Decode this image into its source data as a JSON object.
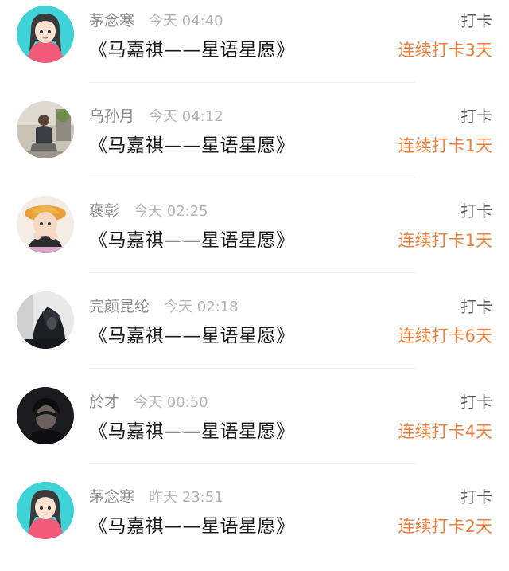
{
  "feed": {
    "items": [
      {
        "name": "茅念寒",
        "time": "今天 04:40",
        "title": "《马嘉祺——星语星愿》",
        "action": "打卡",
        "streak": "连续打卡3天",
        "avatar_icon": "anime-girl-avatar-icon"
      },
      {
        "name": "乌孙月",
        "time": "今天 04:12",
        "title": "《马嘉祺——星语星愿》",
        "action": "打卡",
        "streak": "连续打卡1天",
        "avatar_icon": "man-sitting-photo-avatar-icon"
      },
      {
        "name": "褒彰",
        "time": "今天 02:25",
        "title": "《马嘉祺——星语星愿》",
        "action": "打卡",
        "streak": "连续打卡1天",
        "avatar_icon": "child-with-hat-avatar-icon"
      },
      {
        "name": "完颜昆纶",
        "time": "今天 02:18",
        "title": "《马嘉祺——星语星愿》",
        "action": "打卡",
        "streak": "连续打卡6天",
        "avatar_icon": "dark-hooded-figure-avatar-icon"
      },
      {
        "name": "於才",
        "time": "今天 00:50",
        "title": "《马嘉祺——星语星愿》",
        "action": "打卡",
        "streak": "连续打卡4天",
        "avatar_icon": "dark-portrait-avatar-icon"
      },
      {
        "name": "茅念寒",
        "time": "昨天 23:51",
        "title": "《马嘉祺——星语星愿》",
        "action": "打卡",
        "streak": "连续打卡2天",
        "avatar_icon": "anime-girl-avatar-icon"
      }
    ]
  },
  "colors": {
    "streak": "#f07f3c",
    "name": "#8e8e8e",
    "time": "#b5b5b5",
    "title": "#1a1a1a",
    "action": "#5a5a5a"
  }
}
